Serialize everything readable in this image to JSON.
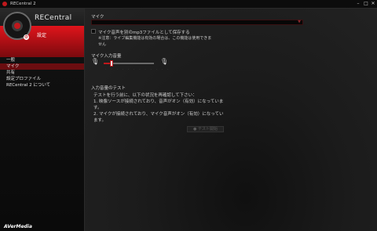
{
  "window": {
    "title": "RECentral 2",
    "controls": {
      "minimize": "–",
      "restore": "□",
      "close": "✕"
    }
  },
  "sidebar": {
    "brand": "RECentral",
    "section": "設定",
    "items": [
      {
        "label": "一般",
        "active": false
      },
      {
        "label": "マイク",
        "active": true
      },
      {
        "label": "共有",
        "active": false
      },
      {
        "label": "設定プロファイル",
        "active": false
      },
      {
        "label": "RECentral 2 について",
        "active": false
      }
    ],
    "footer": "AVerMedia"
  },
  "mic": {
    "title": "マイク",
    "selected": "",
    "save_mp3_label": "マイク音声を別のmp3ファイルとして保存する",
    "note_line1": "※注意：ライブ編集機能は有効の場合は、この機能は使用できま",
    "note_line2": "せん",
    "volume_title": "マイク入力音量",
    "volume_level": 0.15
  },
  "input_test": {
    "title": "入力音量のテスト",
    "line1": "テストを行う前に、以下の状況を再確認して下さい：",
    "line2": "1. 映像ソースが接続されており、音声がオン（有効）になっていま",
    "line3": "す。",
    "line4": "2. マイクが接続されており、マイク音声がオン（有効）になってい",
    "line5": "ます。",
    "test_button": "テスト開始"
  },
  "colors": {
    "accent": "#c0181c",
    "active_item": "#6b0d10"
  }
}
